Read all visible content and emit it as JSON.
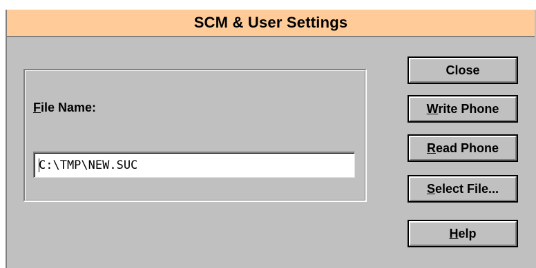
{
  "dialog": {
    "title": "SCM & User Settings"
  },
  "file_name": {
    "label_first": "F",
    "label_rest": "ile Name:",
    "value": "C:\\TMP\\NEW.SUC"
  },
  "buttons": {
    "close": {
      "label": "Close"
    },
    "write_phone": {
      "mnemonic": "W",
      "rest": "rite Phone"
    },
    "read_phone": {
      "mnemonic": "R",
      "rest": "ead Phone"
    },
    "select_file": {
      "mnemonic": "S",
      "rest": "elect File..."
    },
    "help": {
      "mnemonic": "H",
      "rest": "elp"
    }
  },
  "colors": {
    "title_bar": "#ffcc99",
    "dialog_face": "#c0c0c0",
    "text_field": "#ffffff"
  }
}
